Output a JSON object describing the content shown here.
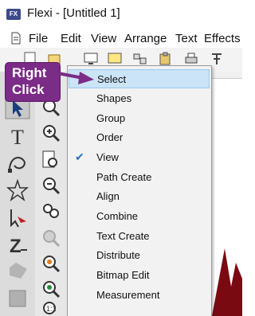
{
  "window": {
    "app_logo": "FX",
    "title": "Flexi - [Untitled 1]"
  },
  "menubar": {
    "items": [
      "File",
      "Edit",
      "View",
      "Arrange",
      "Text",
      "Effects"
    ]
  },
  "context_menu": {
    "items": [
      {
        "label": "Select",
        "highlighted": true,
        "checked": false
      },
      {
        "label": "Shapes",
        "highlighted": false,
        "checked": false
      },
      {
        "label": "Group",
        "highlighted": false,
        "checked": false
      },
      {
        "label": "Order",
        "highlighted": false,
        "checked": false
      },
      {
        "label": "View",
        "highlighted": false,
        "checked": true
      },
      {
        "label": "Path Create",
        "highlighted": false,
        "checked": false
      },
      {
        "label": "Align",
        "highlighted": false,
        "checked": false
      },
      {
        "label": "Combine",
        "highlighted": false,
        "checked": false
      },
      {
        "label": "Text Create",
        "highlighted": false,
        "checked": false
      },
      {
        "label": "Distribute",
        "highlighted": false,
        "checked": false
      },
      {
        "label": "Bitmap Edit",
        "highlighted": false,
        "checked": false
      },
      {
        "label": "Measurement",
        "highlighted": false,
        "checked": false
      }
    ],
    "check_mark": "✔"
  },
  "callout": {
    "line1": "Right",
    "line2": "Click",
    "color": "#7b2c86"
  },
  "colors": {
    "accent_highlight": "#cce4f7",
    "shape_red": "#7a0a12"
  }
}
